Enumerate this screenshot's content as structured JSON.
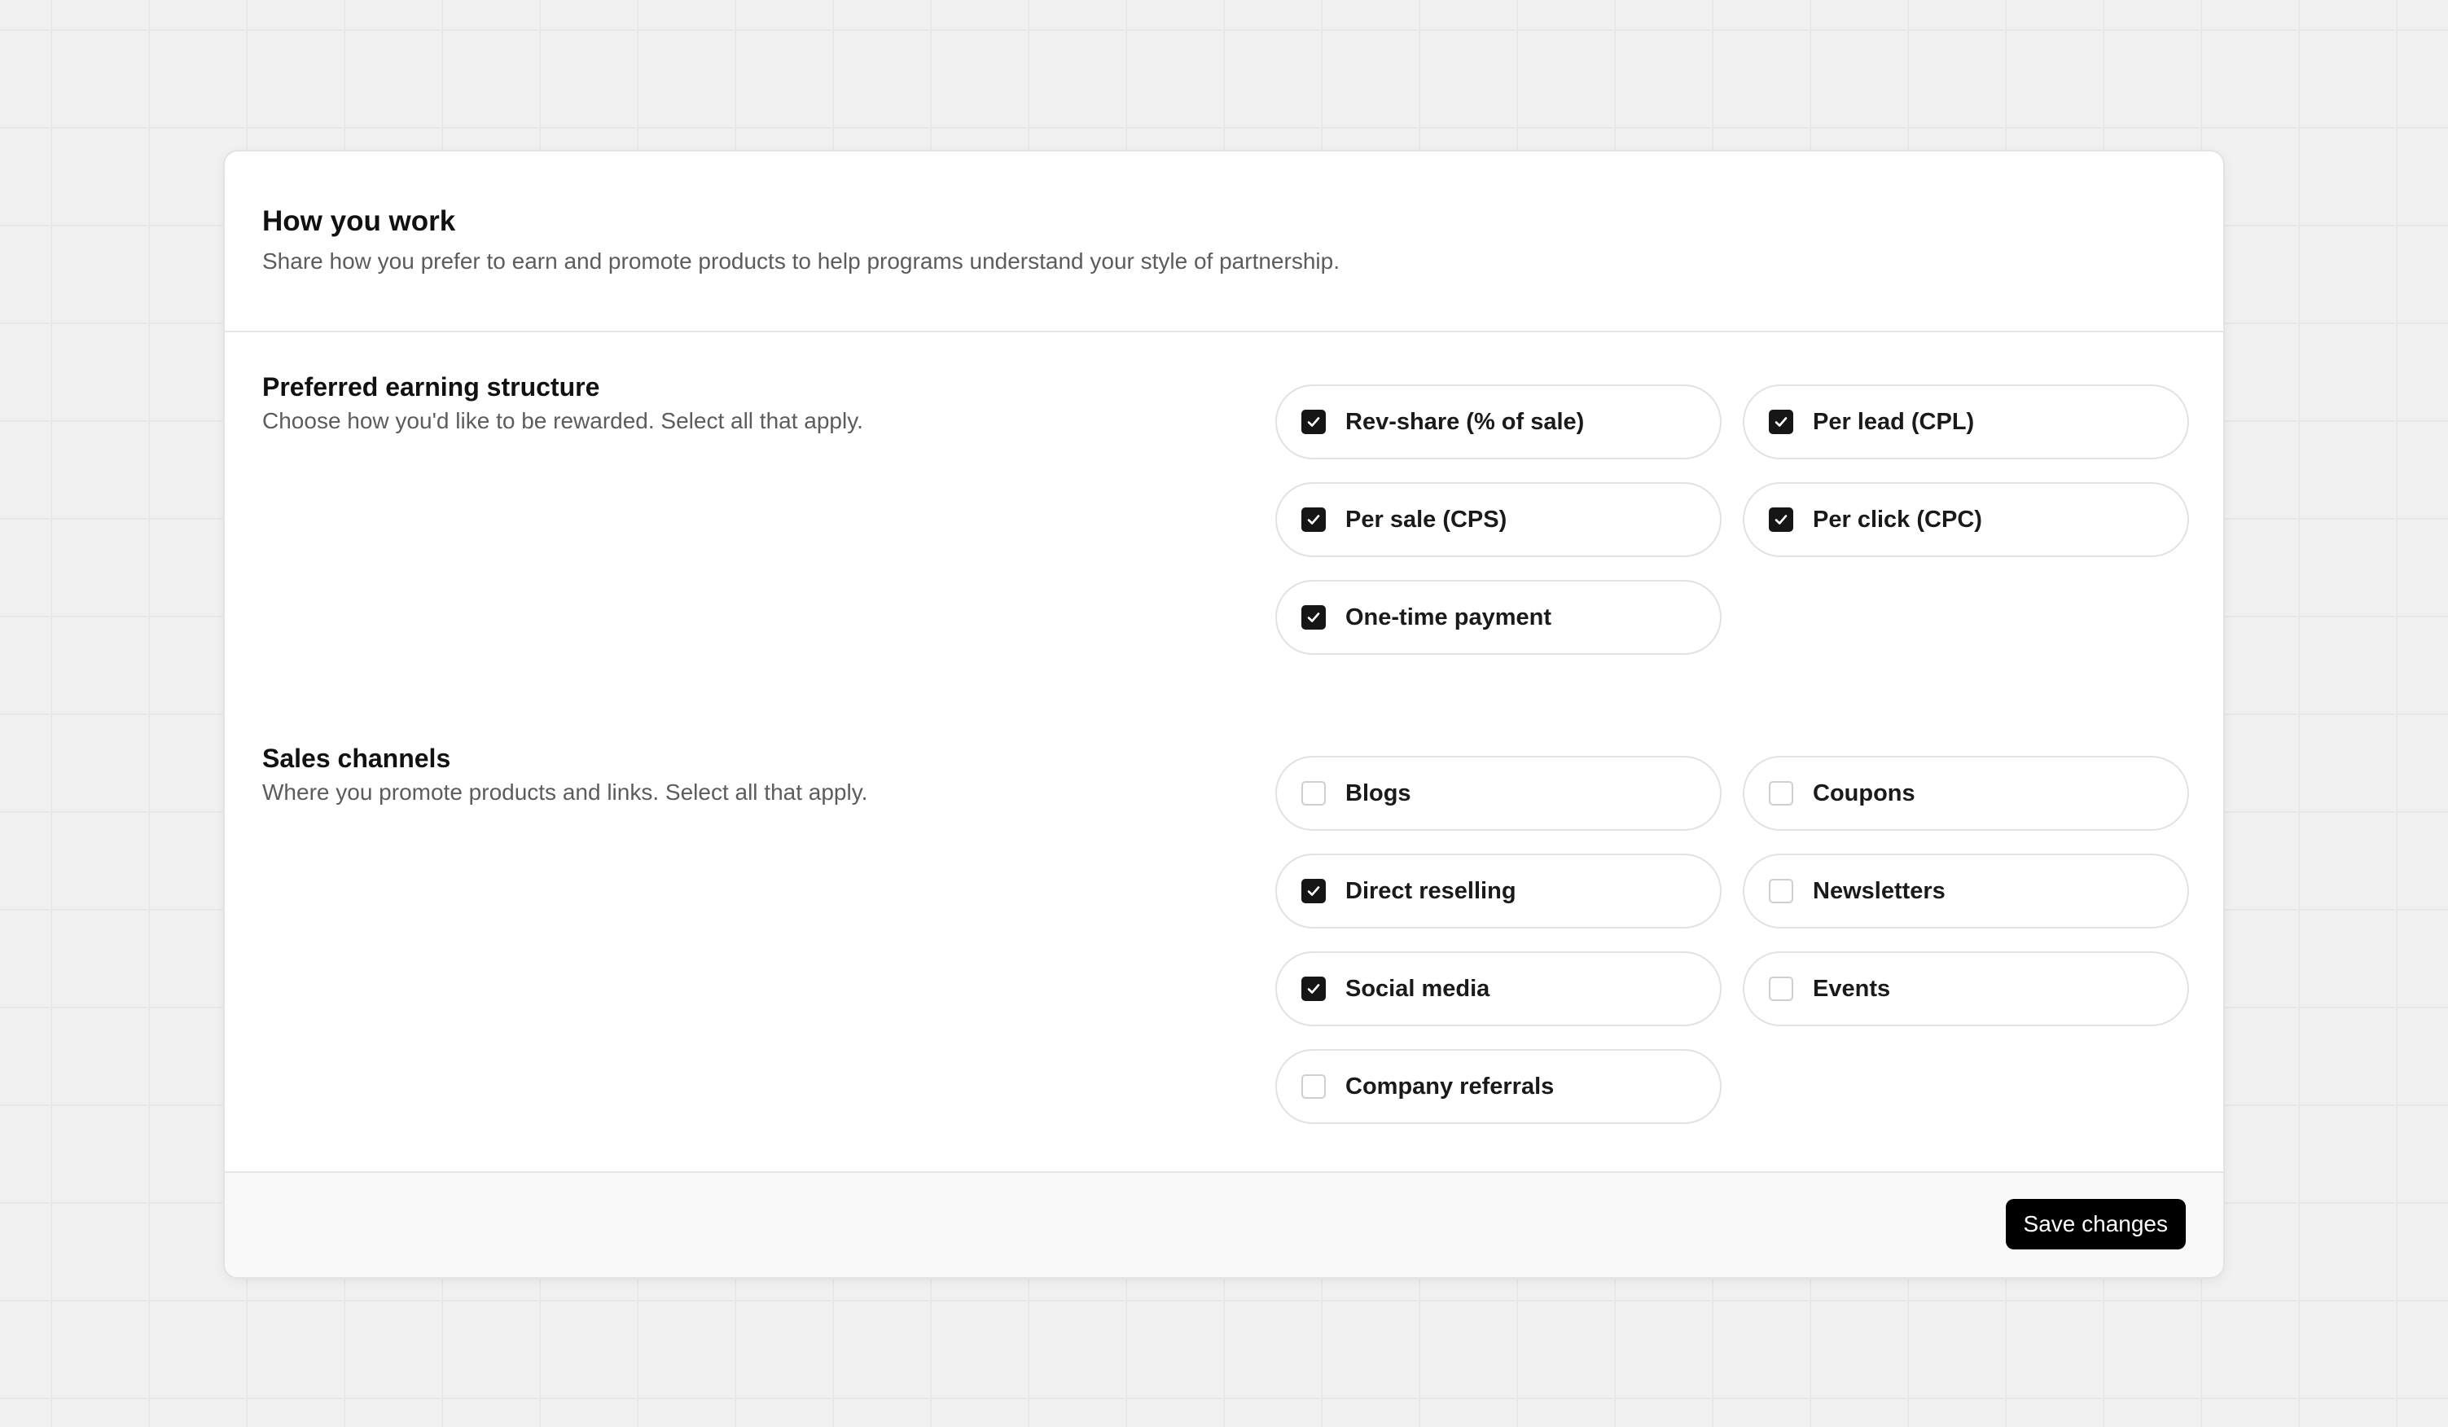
{
  "header": {
    "title": "How you work",
    "description": "Share how you prefer to earn and promote products to help programs understand your style of partnership."
  },
  "earning": {
    "title": "Preferred earning structure",
    "description": "Choose how you'd like to be rewarded. Select all that apply.",
    "options": [
      {
        "label": "Rev-share (% of sale)",
        "checked": true
      },
      {
        "label": "Per lead (CPL)",
        "checked": true
      },
      {
        "label": "Per sale (CPS)",
        "checked": true
      },
      {
        "label": "Per click (CPC)",
        "checked": true
      },
      {
        "label": "One-time payment",
        "checked": true
      }
    ]
  },
  "channels": {
    "title": "Sales channels",
    "description": "Where you promote products and links. Select all that apply.",
    "options": [
      {
        "label": "Blogs",
        "checked": false
      },
      {
        "label": "Coupons",
        "checked": false
      },
      {
        "label": "Direct reselling",
        "checked": true
      },
      {
        "label": "Newsletters",
        "checked": false
      },
      {
        "label": "Social media",
        "checked": true
      },
      {
        "label": "Events",
        "checked": false
      },
      {
        "label": "Company referrals",
        "checked": false
      }
    ]
  },
  "footer": {
    "save_label": "Save changes"
  },
  "colors": {
    "page_background": "#f1f1f1",
    "card_background": "#ffffff",
    "checked_fill": "#161616",
    "button_background": "#000000"
  },
  "icons": {
    "checkmark": "check-icon"
  }
}
